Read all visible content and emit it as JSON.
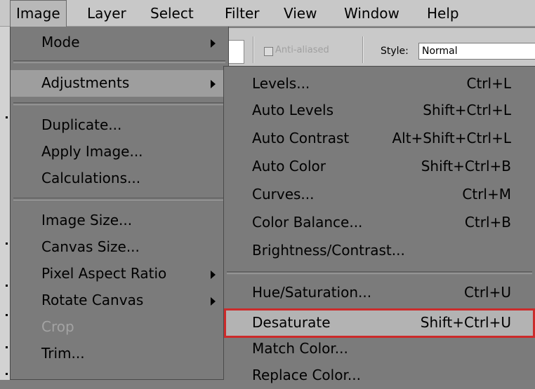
{
  "menubar": {
    "items": [
      "Image",
      "Layer",
      "Select",
      "Filter",
      "View",
      "Window",
      "Help"
    ]
  },
  "options_bar": {
    "anti_aliased_label": "Anti-aliased",
    "style_label": "Style:",
    "style_value": "Normal"
  },
  "image_menu": {
    "items": [
      {
        "label": "Mode",
        "submenu": true
      },
      {
        "label": "Adjustments",
        "submenu": true
      },
      {
        "label": "Duplicate..."
      },
      {
        "label": "Apply Image..."
      },
      {
        "label": "Calculations..."
      },
      {
        "label": "Image Size..."
      },
      {
        "label": "Canvas Size..."
      },
      {
        "label": "Pixel Aspect Ratio",
        "submenu": true
      },
      {
        "label": "Rotate Canvas",
        "submenu": true
      },
      {
        "label": "Crop",
        "disabled": true
      },
      {
        "label": "Trim..."
      }
    ]
  },
  "adjustments_menu": {
    "items": [
      {
        "label": "Levels...",
        "shortcut": "Ctrl+L"
      },
      {
        "label": "Auto Levels",
        "shortcut": "Shift+Ctrl+L"
      },
      {
        "label": "Auto Contrast",
        "shortcut": "Alt+Shift+Ctrl+L"
      },
      {
        "label": "Auto Color",
        "shortcut": "Shift+Ctrl+B"
      },
      {
        "label": "Curves...",
        "shortcut": "Ctrl+M"
      },
      {
        "label": "Color Balance...",
        "shortcut": "Ctrl+B"
      },
      {
        "label": "Brightness/Contrast...",
        "shortcut": ""
      },
      {
        "label": "Hue/Saturation...",
        "shortcut": "Ctrl+U"
      },
      {
        "label": "Desaturate",
        "shortcut": "Shift+Ctrl+U",
        "selected": true
      },
      {
        "label": "Match Color...",
        "shortcut": ""
      },
      {
        "label": "Replace Color...",
        "shortcut": ""
      }
    ]
  },
  "colors": {
    "menu_bg": "#7b7b7b",
    "selection_outline": "#cc2b2b",
    "disabled_text": "#a3a3a3"
  }
}
